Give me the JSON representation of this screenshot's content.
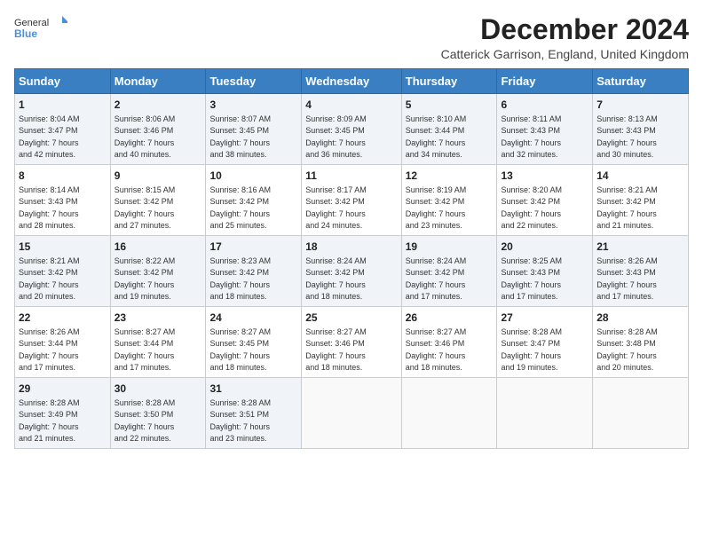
{
  "logo": {
    "general": "General",
    "blue": "Blue"
  },
  "header": {
    "title": "December 2024",
    "subtitle": "Catterick Garrison, England, United Kingdom"
  },
  "weekdays": [
    "Sunday",
    "Monday",
    "Tuesday",
    "Wednesday",
    "Thursday",
    "Friday",
    "Saturday"
  ],
  "weeks": [
    [
      {
        "day": "1",
        "sunrise": "8:04 AM",
        "sunset": "3:47 PM",
        "daylight": "7 hours and 42 minutes."
      },
      {
        "day": "2",
        "sunrise": "8:06 AM",
        "sunset": "3:46 PM",
        "daylight": "7 hours and 40 minutes."
      },
      {
        "day": "3",
        "sunrise": "8:07 AM",
        "sunset": "3:45 PM",
        "daylight": "7 hours and 38 minutes."
      },
      {
        "day": "4",
        "sunrise": "8:09 AM",
        "sunset": "3:45 PM",
        "daylight": "7 hours and 36 minutes."
      },
      {
        "day": "5",
        "sunrise": "8:10 AM",
        "sunset": "3:44 PM",
        "daylight": "7 hours and 34 minutes."
      },
      {
        "day": "6",
        "sunrise": "8:11 AM",
        "sunset": "3:43 PM",
        "daylight": "7 hours and 32 minutes."
      },
      {
        "day": "7",
        "sunrise": "8:13 AM",
        "sunset": "3:43 PM",
        "daylight": "7 hours and 30 minutes."
      }
    ],
    [
      {
        "day": "8",
        "sunrise": "8:14 AM",
        "sunset": "3:43 PM",
        "daylight": "7 hours and 28 minutes."
      },
      {
        "day": "9",
        "sunrise": "8:15 AM",
        "sunset": "3:42 PM",
        "daylight": "7 hours and 27 minutes."
      },
      {
        "day": "10",
        "sunrise": "8:16 AM",
        "sunset": "3:42 PM",
        "daylight": "7 hours and 25 minutes."
      },
      {
        "day": "11",
        "sunrise": "8:17 AM",
        "sunset": "3:42 PM",
        "daylight": "7 hours and 24 minutes."
      },
      {
        "day": "12",
        "sunrise": "8:19 AM",
        "sunset": "3:42 PM",
        "daylight": "7 hours and 23 minutes."
      },
      {
        "day": "13",
        "sunrise": "8:20 AM",
        "sunset": "3:42 PM",
        "daylight": "7 hours and 22 minutes."
      },
      {
        "day": "14",
        "sunrise": "8:21 AM",
        "sunset": "3:42 PM",
        "daylight": "7 hours and 21 minutes."
      }
    ],
    [
      {
        "day": "15",
        "sunrise": "8:21 AM",
        "sunset": "3:42 PM",
        "daylight": "7 hours and 20 minutes."
      },
      {
        "day": "16",
        "sunrise": "8:22 AM",
        "sunset": "3:42 PM",
        "daylight": "7 hours and 19 minutes."
      },
      {
        "day": "17",
        "sunrise": "8:23 AM",
        "sunset": "3:42 PM",
        "daylight": "7 hours and 18 minutes."
      },
      {
        "day": "18",
        "sunrise": "8:24 AM",
        "sunset": "3:42 PM",
        "daylight": "7 hours and 18 minutes."
      },
      {
        "day": "19",
        "sunrise": "8:24 AM",
        "sunset": "3:42 PM",
        "daylight": "7 hours and 17 minutes."
      },
      {
        "day": "20",
        "sunrise": "8:25 AM",
        "sunset": "3:43 PM",
        "daylight": "7 hours and 17 minutes."
      },
      {
        "day": "21",
        "sunrise": "8:26 AM",
        "sunset": "3:43 PM",
        "daylight": "7 hours and 17 minutes."
      }
    ],
    [
      {
        "day": "22",
        "sunrise": "8:26 AM",
        "sunset": "3:44 PM",
        "daylight": "7 hours and 17 minutes."
      },
      {
        "day": "23",
        "sunrise": "8:27 AM",
        "sunset": "3:44 PM",
        "daylight": "7 hours and 17 minutes."
      },
      {
        "day": "24",
        "sunrise": "8:27 AM",
        "sunset": "3:45 PM",
        "daylight": "7 hours and 18 minutes."
      },
      {
        "day": "25",
        "sunrise": "8:27 AM",
        "sunset": "3:46 PM",
        "daylight": "7 hours and 18 minutes."
      },
      {
        "day": "26",
        "sunrise": "8:27 AM",
        "sunset": "3:46 PM",
        "daylight": "7 hours and 18 minutes."
      },
      {
        "day": "27",
        "sunrise": "8:28 AM",
        "sunset": "3:47 PM",
        "daylight": "7 hours and 19 minutes."
      },
      {
        "day": "28",
        "sunrise": "8:28 AM",
        "sunset": "3:48 PM",
        "daylight": "7 hours and 20 minutes."
      }
    ],
    [
      {
        "day": "29",
        "sunrise": "8:28 AM",
        "sunset": "3:49 PM",
        "daylight": "7 hours and 21 minutes."
      },
      {
        "day": "30",
        "sunrise": "8:28 AM",
        "sunset": "3:50 PM",
        "daylight": "7 hours and 22 minutes."
      },
      {
        "day": "31",
        "sunrise": "8:28 AM",
        "sunset": "3:51 PM",
        "daylight": "7 hours and 23 minutes."
      },
      null,
      null,
      null,
      null
    ]
  ]
}
